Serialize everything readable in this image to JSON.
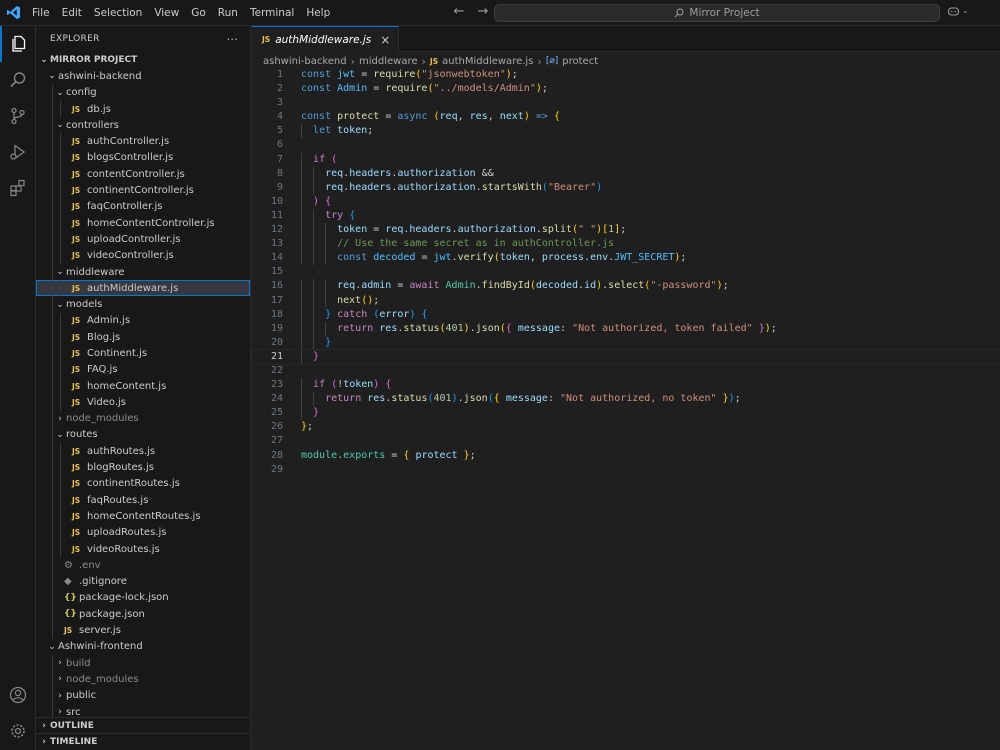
{
  "menu": [
    "File",
    "Edit",
    "Selection",
    "View",
    "Go",
    "Run",
    "Terminal",
    "Help"
  ],
  "search": {
    "text": "Mirror Project"
  },
  "explorer": {
    "title": "EXPLORER",
    "more": "···",
    "root": "MIRROR PROJECT",
    "tree": [
      {
        "label": "ashwini-backend",
        "depth": 1,
        "type": "folder-open"
      },
      {
        "label": "config",
        "depth": 2,
        "type": "folder-open"
      },
      {
        "label": "db.js",
        "depth": 3,
        "type": "js"
      },
      {
        "label": "controllers",
        "depth": 2,
        "type": "folder-open"
      },
      {
        "label": "authController.js",
        "depth": 3,
        "type": "js"
      },
      {
        "label": "blogsController.js",
        "depth": 3,
        "type": "js"
      },
      {
        "label": "contentController.js",
        "depth": 3,
        "type": "js"
      },
      {
        "label": "continentController.js",
        "depth": 3,
        "type": "js"
      },
      {
        "label": "faqController.js",
        "depth": 3,
        "type": "js"
      },
      {
        "label": "homeContentController.js",
        "depth": 3,
        "type": "js"
      },
      {
        "label": "uploadController.js",
        "depth": 3,
        "type": "js"
      },
      {
        "label": "videoController.js",
        "depth": 3,
        "type": "js"
      },
      {
        "label": "middleware",
        "depth": 2,
        "type": "folder-open"
      },
      {
        "label": "authMiddleware.js",
        "depth": 3,
        "type": "js",
        "selected": true
      },
      {
        "label": "models",
        "depth": 2,
        "type": "folder-open"
      },
      {
        "label": "Admin.js",
        "depth": 3,
        "type": "js"
      },
      {
        "label": "Blog.js",
        "depth": 3,
        "type": "js"
      },
      {
        "label": "Continent.js",
        "depth": 3,
        "type": "js"
      },
      {
        "label": "FAQ.js",
        "depth": 3,
        "type": "js"
      },
      {
        "label": "homeContent.js",
        "depth": 3,
        "type": "js"
      },
      {
        "label": "Video.js",
        "depth": 3,
        "type": "js"
      },
      {
        "label": "node_modules",
        "depth": 2,
        "type": "folder-closed",
        "dim": true
      },
      {
        "label": "routes",
        "depth": 2,
        "type": "folder-open"
      },
      {
        "label": "authRoutes.js",
        "depth": 3,
        "type": "js"
      },
      {
        "label": "blogRoutes.js",
        "depth": 3,
        "type": "js"
      },
      {
        "label": "continentRoutes.js",
        "depth": 3,
        "type": "js"
      },
      {
        "label": "faqRoutes.js",
        "depth": 3,
        "type": "js"
      },
      {
        "label": "homeContentRoutes.js",
        "depth": 3,
        "type": "js"
      },
      {
        "label": "uploadRoutes.js",
        "depth": 3,
        "type": "js"
      },
      {
        "label": "videoRoutes.js",
        "depth": 3,
        "type": "js"
      },
      {
        "label": ".env",
        "depth": 2,
        "type": "gear",
        "dim": true
      },
      {
        "label": ".gitignore",
        "depth": 2,
        "type": "git"
      },
      {
        "label": "package-lock.json",
        "depth": 2,
        "type": "json"
      },
      {
        "label": "package.json",
        "depth": 2,
        "type": "json"
      },
      {
        "label": "server.js",
        "depth": 2,
        "type": "js"
      },
      {
        "label": "Ashwini-frontend",
        "depth": 1,
        "type": "folder-open"
      },
      {
        "label": "build",
        "depth": 2,
        "type": "folder-closed",
        "dim": true
      },
      {
        "label": "node_modules",
        "depth": 2,
        "type": "folder-closed",
        "dim": true
      },
      {
        "label": "public",
        "depth": 2,
        "type": "folder-closed"
      },
      {
        "label": "src",
        "depth": 2,
        "type": "folder-closed"
      }
    ],
    "outline": "OUTLINE",
    "timeline": "TIMELINE"
  },
  "tab": {
    "label": "authMiddleware.js",
    "icon": "JS"
  },
  "breadcrumb": {
    "parts": [
      "ashwini-backend",
      "middleware",
      "authMiddleware.js",
      "protect"
    ]
  },
  "editor": {
    "current_line": 21,
    "line_numbers": [
      "1",
      "2",
      "3",
      "4",
      "5",
      "6",
      "7",
      "8",
      "9",
      "10",
      "11",
      "12",
      "13",
      "14",
      "15",
      "16",
      "17",
      "18",
      "19",
      "20",
      "21",
      "22",
      "23",
      "24",
      "25",
      "26",
      "27",
      "28",
      "29"
    ]
  },
  "colors": {
    "accent": "#0078d4",
    "js_icon": "#e8c247",
    "background": "#1f1f1f"
  }
}
